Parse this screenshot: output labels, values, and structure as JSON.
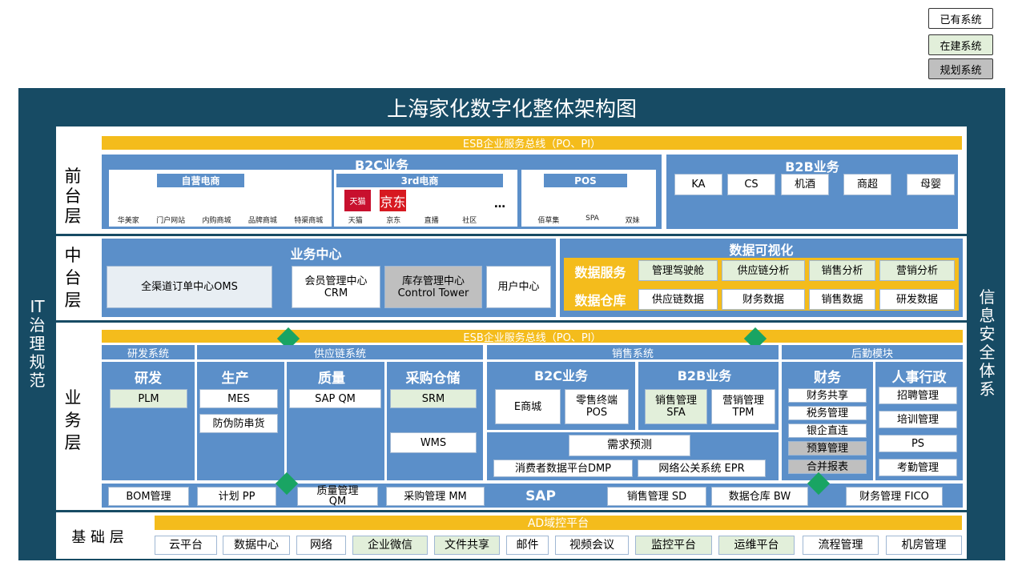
{
  "legend": {
    "existing": "已有系统",
    "building": "在建系统",
    "planned": "规划系统"
  },
  "title": "上海家化数字化整体架构图",
  "left_rail": [
    "IT",
    "治",
    "理",
    "规",
    "范"
  ],
  "right_rail": [
    "信",
    "息",
    "安",
    "全",
    "体",
    "系"
  ],
  "layers": {
    "front": [
      "前",
      "台",
      "层"
    ],
    "middle": [
      "中",
      "台",
      "层"
    ],
    "business": [
      "业",
      "务",
      "层"
    ],
    "base": "基 础 层"
  },
  "esb_label": "ESB企业服务总线（PO、PI）",
  "front": {
    "b2c_title": "B2C业务",
    "self_ecom": {
      "title": "自营电商",
      "items": [
        "华美家",
        "门户网站",
        "内购商城",
        "品牌商城",
        "特渠商城"
      ]
    },
    "third_ecom": {
      "title": "3rd电商",
      "tmall_icon": "天猫",
      "jd_icon": "京东",
      "items": [
        "天猫",
        "京东",
        "直播",
        "社区"
      ],
      "more": "…"
    },
    "pos": {
      "title": "POS",
      "items": [
        "佰草集",
        "SPA",
        "双妹"
      ]
    },
    "b2b_title": "B2B业务",
    "b2b_items": [
      "KA",
      "CS",
      "机酒",
      "商超",
      "母婴"
    ]
  },
  "middle": {
    "biz_center": "业务中心",
    "oms": "全渠道订单中心OMS",
    "crm": [
      "会员管理中心",
      "CRM"
    ],
    "inventory": [
      "库存管理中心",
      "Control Tower"
    ],
    "user": "用户中心",
    "viz_title": "数据可视化",
    "data_service": "数据服务",
    "data_warehouse": "数据仓库",
    "service_items": [
      "管理驾驶舱",
      "供应链分析",
      "销售分析",
      "营销分析"
    ],
    "warehouse_items": [
      "供应链数据",
      "财务数据",
      "销售数据",
      "研发数据"
    ]
  },
  "business": {
    "tabs": {
      "rd": "研发系统",
      "supply": "供应链系统",
      "sales": "销售系统",
      "backoffice": "后勤模块"
    },
    "rd": {
      "title": "研发",
      "plm": "PLM"
    },
    "production": {
      "title": "生产",
      "mes": "MES",
      "anti": "防伪防串货"
    },
    "quality": {
      "title": "质量",
      "qm": "SAP QM"
    },
    "purchase": {
      "title": "采购仓储",
      "srm": "SRM",
      "wms": "WMS"
    },
    "b2c": {
      "title": "B2C业务",
      "emall": "E商城",
      "retail": [
        "零售终端",
        "POS"
      ]
    },
    "b2b": {
      "title": "B2B业务",
      "sfa": [
        "销售管理",
        "SFA"
      ],
      "tpm": [
        "营销管理",
        "TPM"
      ]
    },
    "demand": "需求预测",
    "dmp": "消费者数据平台DMP",
    "epr": "网络公关系统 EPR",
    "finance": {
      "title": "财务",
      "items": [
        "财务共享",
        "税务管理",
        "银企直连",
        "预算管理",
        "合并报表"
      ]
    },
    "hr": {
      "title": "人事行政",
      "items": [
        "招聘管理",
        "培训管理",
        "PS",
        "考勤管理"
      ]
    },
    "sap": {
      "label": "SAP",
      "bom": "BOM管理",
      "pp": "计划 PP",
      "qm": [
        "质量管理",
        "QM"
      ],
      "mm": "采购管理 MM",
      "sd": "销售管理 SD",
      "bw": "数据仓库 BW",
      "fico": "财务管理 FICO"
    }
  },
  "base": {
    "ad": "AD域控平台",
    "items": [
      "云平台",
      "数据中心",
      "网络",
      "企业微信",
      "文件共享",
      "邮件",
      "视频会议",
      "监控平台",
      "运维平台",
      "流程管理",
      "机房管理"
    ]
  },
  "colors": {
    "dark": "#174b64",
    "blue": "#5b8fc9",
    "esb": "#f4bc1c",
    "building": "#e2efda",
    "planned": "#bfbfbf",
    "diamond": "#19a463"
  }
}
